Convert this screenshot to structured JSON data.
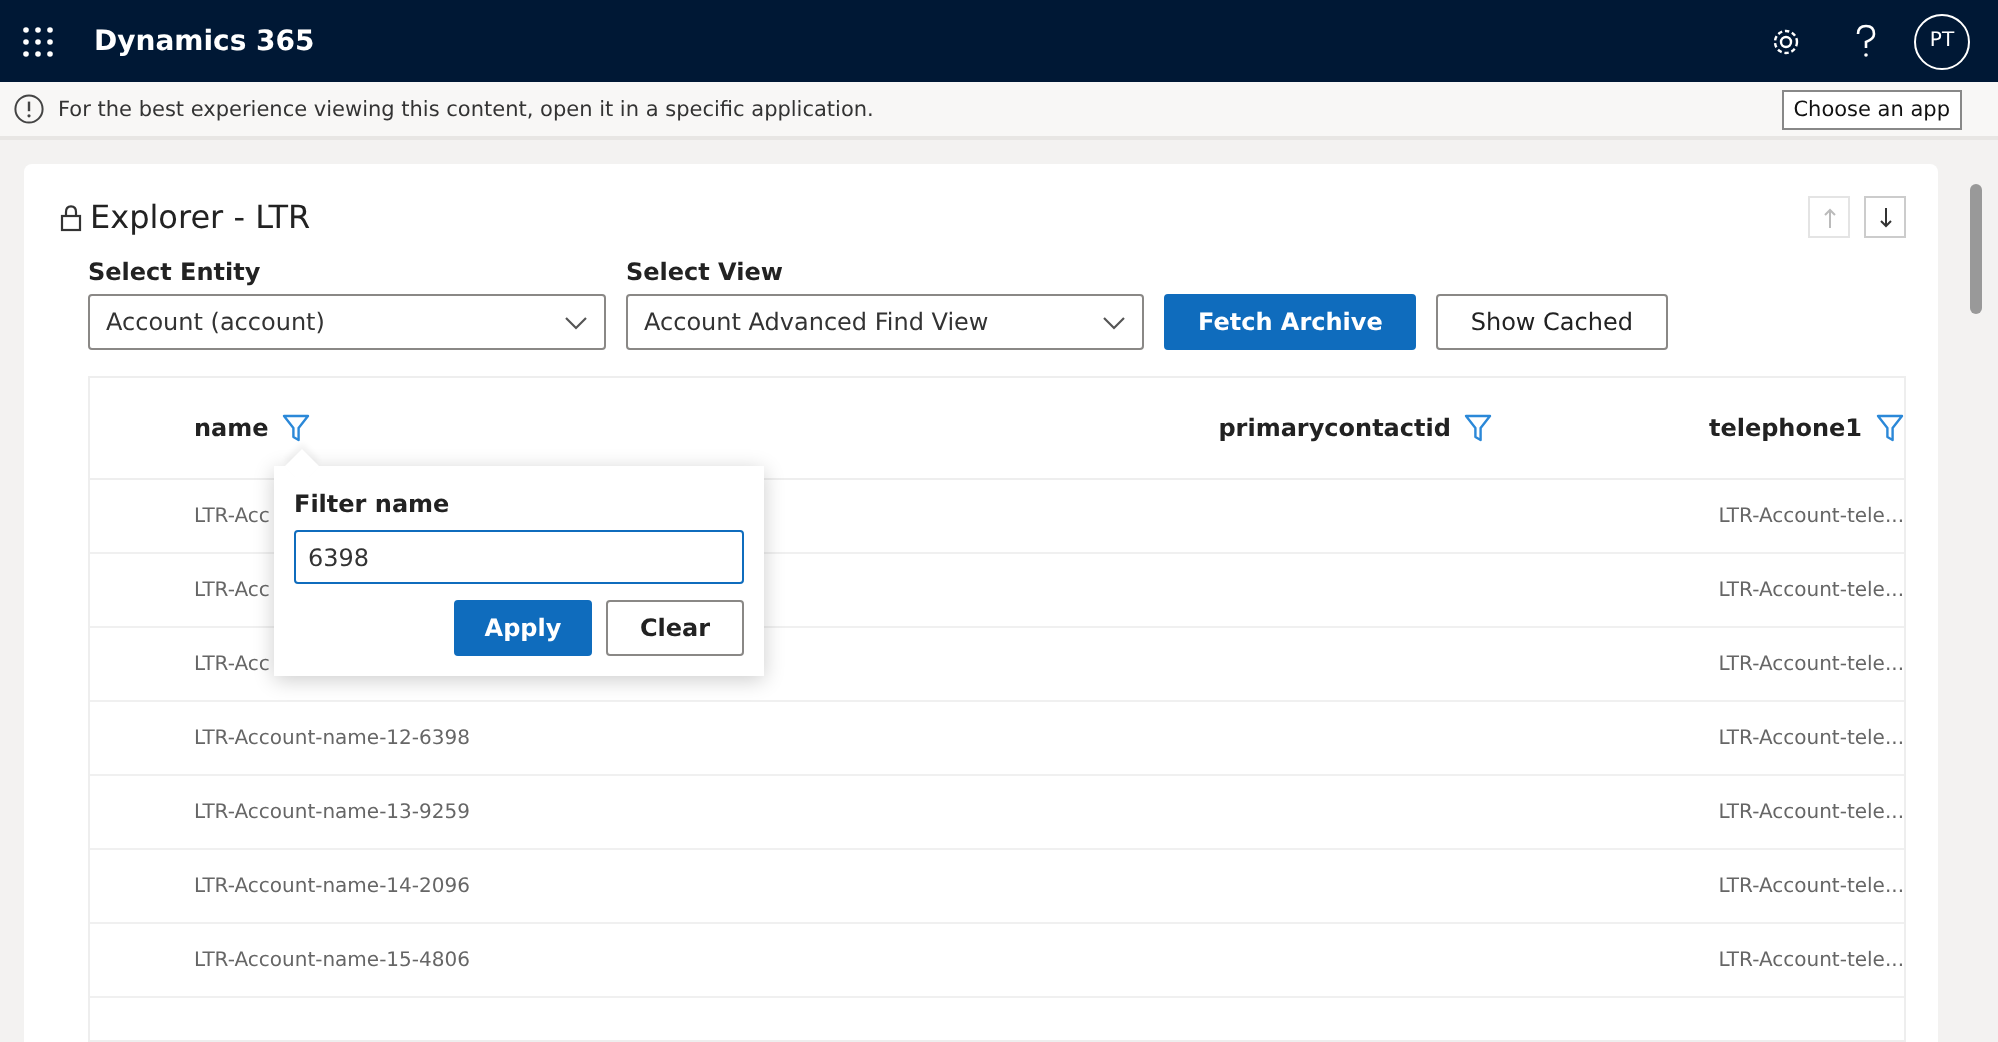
{
  "topbar": {
    "app_title": "Dynamics 365",
    "avatar": "PT"
  },
  "notice": {
    "text": "For the best experience viewing this content, open it in a specific application.",
    "button": "Choose an app"
  },
  "panel": {
    "title": "Explorer - LTR",
    "entity": {
      "label": "Select Entity",
      "value": "Account (account)"
    },
    "view": {
      "label": "Select View",
      "value": "Account Advanced Find View"
    },
    "buttons": [
      {
        "label": "Fetch Archive",
        "kind": "primary"
      },
      {
        "label": "Show Cached",
        "kind": "secondary"
      }
    ]
  },
  "table": {
    "columns": [
      {
        "label": "name"
      },
      {
        "label": "primarycontactid"
      },
      {
        "label": "telephone1"
      }
    ],
    "rows": [
      {
        "name": "LTR-Acc",
        "telephone1": "LTR-Account-tele..."
      },
      {
        "name": "LTR-Acc",
        "telephone1": "LTR-Account-tele..."
      },
      {
        "name": "LTR-Acc",
        "telephone1": "LTR-Account-tele..."
      },
      {
        "name": "LTR-Account-name-12-6398",
        "telephone1": "LTR-Account-tele..."
      },
      {
        "name": "LTR-Account-name-13-9259",
        "telephone1": "LTR-Account-tele..."
      },
      {
        "name": "LTR-Account-name-14-2096",
        "telephone1": "LTR-Account-tele..."
      },
      {
        "name": "LTR-Account-name-15-4806",
        "telephone1": "LTR-Account-tele..."
      }
    ]
  },
  "filter_popup": {
    "title": "Filter name",
    "value": "6398",
    "buttons": [
      {
        "label": "Apply",
        "kind": "primary"
      },
      {
        "label": "Clear",
        "kind": "secondary"
      }
    ]
  }
}
